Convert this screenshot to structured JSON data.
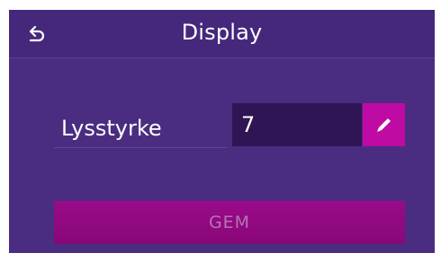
{
  "header": {
    "back_icon": "back-arrow-icon",
    "title": "Display"
  },
  "form": {
    "brightness_label": "Lysstyrke",
    "brightness_value": "7",
    "edit_icon": "pencil-icon"
  },
  "actions": {
    "save_label": "GEM",
    "save_enabled": false
  },
  "colors": {
    "background": "#4a2d80",
    "header": "#45287c",
    "field": "#2f1553",
    "accent": "#bf0aa3",
    "save_button": "#8f0980",
    "save_text_disabled": "#b872b6"
  }
}
